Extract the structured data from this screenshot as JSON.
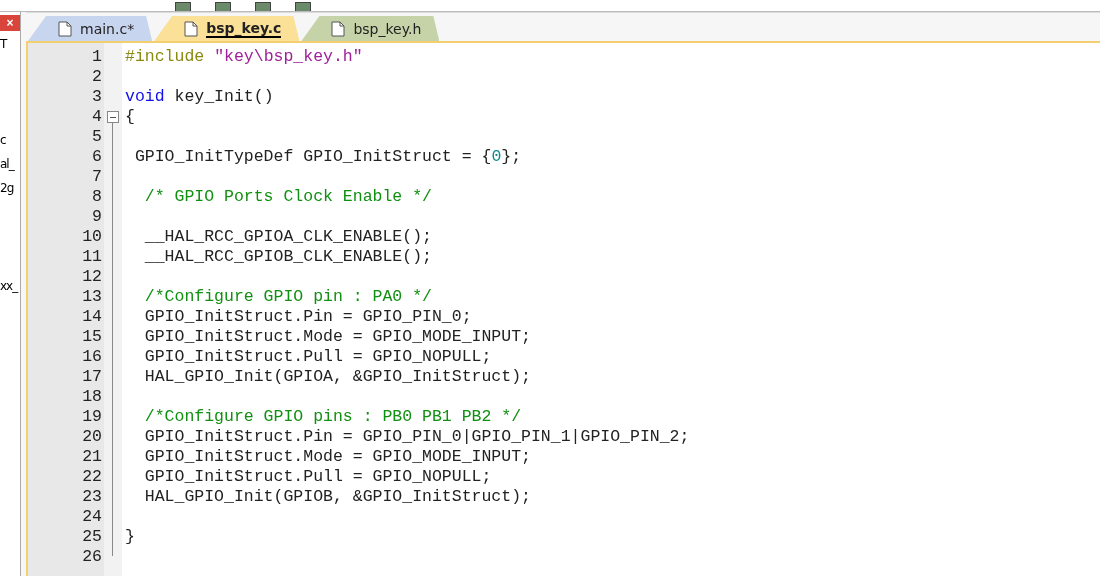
{
  "side_panel": {
    "close_label": "×",
    "fragments": [
      "T",
      "c",
      "al_",
      "2g",
      "xx_"
    ]
  },
  "tabs": [
    {
      "label": "main.c*",
      "color": "#c8d5ef",
      "selected": false
    },
    {
      "label": "bsp_key.c",
      "color": "#fbe197",
      "selected": true
    },
    {
      "label": "bsp_key.h",
      "color": "#c6d3a8",
      "selected": false
    }
  ],
  "editor": {
    "lines": [
      {
        "number": "1",
        "tokens": [
          {
            "kind": "preprocessor",
            "text": "#include "
          },
          {
            "kind": "string",
            "text": "\"key\\bsp_key.h\""
          }
        ]
      },
      {
        "number": "2"
      },
      {
        "number": "3",
        "tokens": [
          {
            "kind": "keyword",
            "text": "void"
          },
          {
            "kind": "plain",
            "text": " key_Init()"
          }
        ]
      },
      {
        "number": "4",
        "fold_expanded": true,
        "tokens": [
          {
            "kind": "plain",
            "text": "{"
          }
        ]
      },
      {
        "number": "5"
      },
      {
        "number": "6",
        "tokens": [
          {
            "kind": "plain",
            "text": " GPIO_InitTypeDef GPIO_InitStruct = {"
          },
          {
            "kind": "number",
            "text": "0"
          },
          {
            "kind": "plain",
            "text": "};"
          }
        ]
      },
      {
        "number": "7"
      },
      {
        "number": "8",
        "tokens": [
          {
            "kind": "comment",
            "text": "  /* GPIO Ports Clock Enable */"
          }
        ]
      },
      {
        "number": "9"
      },
      {
        "number": "10",
        "tokens": [
          {
            "kind": "plain",
            "text": "  __HAL_RCC_GPIOA_CLK_ENABLE();"
          }
        ]
      },
      {
        "number": "11",
        "tokens": [
          {
            "kind": "plain",
            "text": "  __HAL_RCC_GPIOB_CLK_ENABLE();"
          }
        ]
      },
      {
        "number": "12"
      },
      {
        "number": "13",
        "tokens": [
          {
            "kind": "comment",
            "text": "  /*Configure GPIO pin : PA0 */"
          }
        ]
      },
      {
        "number": "14",
        "tokens": [
          {
            "kind": "plain",
            "text": "  GPIO_InitStruct.Pin = GPIO_PIN_0;"
          }
        ]
      },
      {
        "number": "15",
        "tokens": [
          {
            "kind": "plain",
            "text": "  GPIO_InitStruct.Mode = GPIO_MODE_INPUT;"
          }
        ]
      },
      {
        "number": "16",
        "tokens": [
          {
            "kind": "plain",
            "text": "  GPIO_InitStruct.Pull = GPIO_NOPULL;"
          }
        ]
      },
      {
        "number": "17",
        "tokens": [
          {
            "kind": "plain",
            "text": "  HAL_GPIO_Init(GPIOA, &GPIO_InitStruct);"
          }
        ]
      },
      {
        "number": "18"
      },
      {
        "number": "19",
        "tokens": [
          {
            "kind": "comment",
            "text": "  /*Configure GPIO pins : PB0 PB1 PB2 */"
          }
        ]
      },
      {
        "number": "20",
        "tokens": [
          {
            "kind": "plain",
            "text": "  GPIO_InitStruct.Pin = GPIO_PIN_0|GPIO_PIN_1|GPIO_PIN_2;"
          }
        ]
      },
      {
        "number": "21",
        "tokens": [
          {
            "kind": "plain",
            "text": "  GPIO_InitStruct.Mode = GPIO_MODE_INPUT;"
          }
        ]
      },
      {
        "number": "22",
        "tokens": [
          {
            "kind": "plain",
            "text": "  GPIO_InitStruct.Pull = GPIO_NOPULL;"
          }
        ]
      },
      {
        "number": "23",
        "tokens": [
          {
            "kind": "plain",
            "text": "  HAL_GPIO_Init(GPIOB, &GPIO_InitStruct);"
          }
        ]
      },
      {
        "number": "24"
      },
      {
        "number": "25",
        "tokens": [
          {
            "kind": "plain",
            "text": "}"
          }
        ]
      },
      {
        "number": "26"
      }
    ]
  }
}
